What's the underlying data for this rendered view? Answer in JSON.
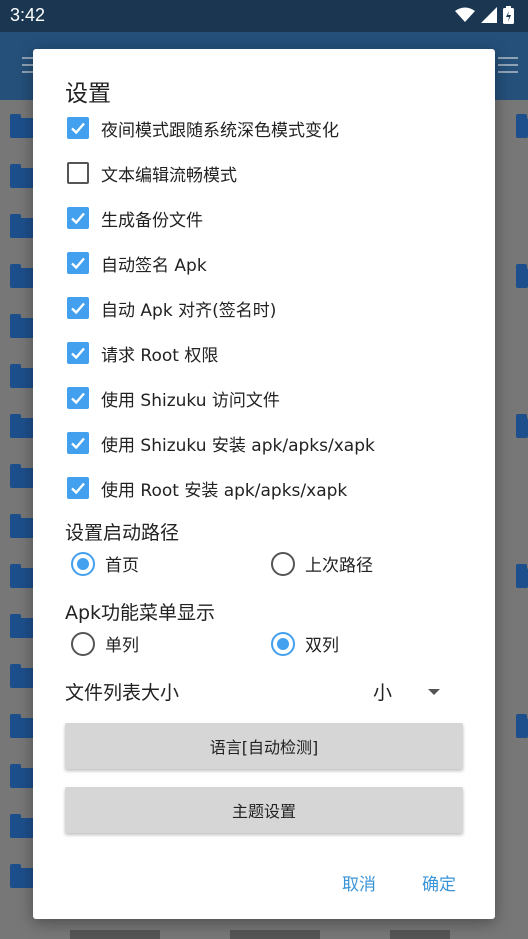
{
  "status_bar": {
    "time": "3:42",
    "icons": [
      "wifi-icon",
      "signal-icon",
      "battery-charging-icon"
    ]
  },
  "dialog": {
    "title": "设置",
    "checkboxes": [
      {
        "label": "夜间模式跟随系统深色模式变化",
        "checked": true
      },
      {
        "label": "文本编辑流畅模式",
        "checked": false
      },
      {
        "label": "生成备份文件",
        "checked": true
      },
      {
        "label": "自动签名 Apk",
        "checked": true
      },
      {
        "label": "自动 Apk 对齐(签名时)",
        "checked": true
      },
      {
        "label": "请求 Root 权限",
        "checked": true
      },
      {
        "label": "使用 Shizuku 访问文件",
        "checked": true
      },
      {
        "label": "使用 Shizuku 安装 apk/apks/xapk",
        "checked": true
      },
      {
        "label": "使用 Root 安装 apk/apks/xapk",
        "checked": true
      }
    ],
    "start_path": {
      "label": "设置启动路径",
      "options": [
        {
          "label": "首页",
          "selected": true
        },
        {
          "label": "上次路径",
          "selected": false
        }
      ]
    },
    "apk_menu": {
      "label": "Apk功能菜单显示",
      "options": [
        {
          "label": "单列",
          "selected": false
        },
        {
          "label": "双列",
          "selected": true
        }
      ]
    },
    "file_list_size": {
      "label": "文件列表大小",
      "value": "小"
    },
    "language_button": "语言[自动检测]",
    "theme_button": "主题设置",
    "cancel": "取消",
    "confirm": "确定"
  },
  "colors": {
    "accent": "#42a0ee",
    "appbar": "#25507a",
    "statusbar": "#1a3650"
  }
}
